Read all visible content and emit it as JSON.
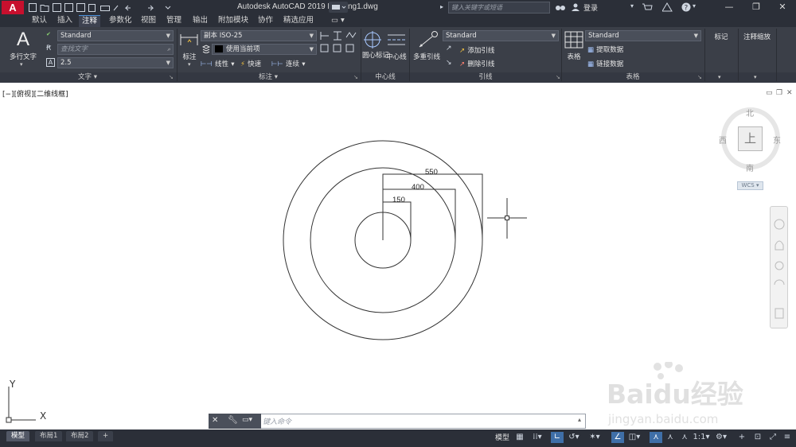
{
  "app": {
    "title_text": "Autodesk AutoCAD 2019    Drawing1.dwg",
    "logo": "A",
    "search_placeholder": "键入关键字或短语",
    "login": "登录",
    "window_controls": [
      "—",
      "❐",
      "✕"
    ]
  },
  "tabs": [
    "默认",
    "插入",
    "注释",
    "参数化",
    "视图",
    "管理",
    "输出",
    "附加模块",
    "协作",
    "精选应用"
  ],
  "active_tab": "注释",
  "ribbon": {
    "text_panel": {
      "big_button": "多行文字",
      "style": "Standard",
      "find_placeholder": "查找文字",
      "height": "2.5",
      "label": "文字 ▾"
    },
    "dim_panel": {
      "big_button": "标注",
      "style": "副本 ISO-25",
      "layer": "使用当前项",
      "linear": "线性",
      "quick": "快速",
      "continue": "连续",
      "label": "标注 ▾"
    },
    "centerline_panel": {
      "center_mark": "圆心标记",
      "centerline": "中心线",
      "label": "中心线"
    },
    "leader_panel": {
      "big_button": "多重引线",
      "style": "Standard",
      "add": "添加引线",
      "remove": "删除引线",
      "label": "引线"
    },
    "table_panel": {
      "big_button": "表格",
      "style": "Standard",
      "extract": "提取数据",
      "link": "链接数据",
      "label": "表格"
    },
    "markup_panel": {
      "title": "标记"
    },
    "scale_panel": {
      "title": "注释缩放"
    }
  },
  "viewport": {
    "label": "[−][俯视][二维线框]",
    "dimensions": [
      "550",
      "400",
      "150"
    ]
  },
  "viewcube": {
    "north": "北",
    "south": "南",
    "east": "东",
    "west": "西",
    "top": "上",
    "wcs": "WCS ▾"
  },
  "ucs": {
    "x": "X",
    "y": "Y"
  },
  "command": {
    "placeholder": "键入命令"
  },
  "layout_tabs": [
    "模型",
    "布局1",
    "布局2",
    "+"
  ],
  "status": {
    "model": "模型",
    "scale": "1:1"
  },
  "watermark": {
    "brand": "Baidu经验",
    "url": "jingyan.baidu.com"
  },
  "colors": {
    "chrome_dark": "#2b2f38",
    "ribbon_bg": "#3b3f48",
    "accent": "#c8102e",
    "active_blue": "#3f6fa8"
  }
}
